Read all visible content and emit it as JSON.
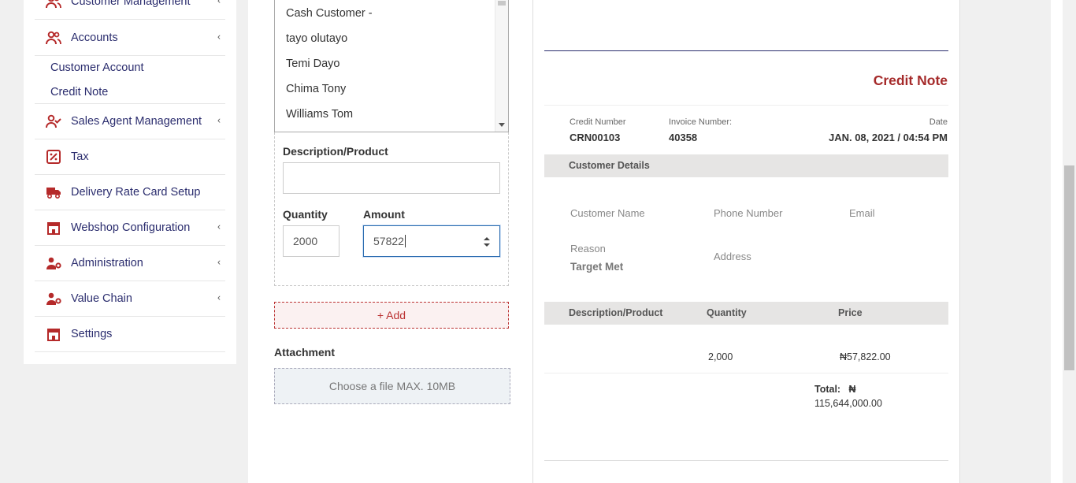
{
  "sidebar": {
    "items": [
      {
        "label": "Customer Management",
        "icon": "users-icon",
        "has_chevron": true
      },
      {
        "label": "Accounts",
        "icon": "users-icon",
        "has_chevron": true
      },
      {
        "label": "Sales Agent Management",
        "icon": "user-check-icon",
        "has_chevron": true
      },
      {
        "label": "Tax",
        "icon": "percent-icon",
        "has_chevron": false
      },
      {
        "label": "Delivery Rate Card Setup",
        "icon": "truck-icon",
        "has_chevron": false
      },
      {
        "label": "Webshop Configuration",
        "icon": "store-icon",
        "has_chevron": true
      },
      {
        "label": "Administration",
        "icon": "user-gear-icon",
        "has_chevron": true
      },
      {
        "label": "Value Chain",
        "icon": "user-gear-icon",
        "has_chevron": true
      },
      {
        "label": "Settings",
        "icon": "store-icon",
        "has_chevron": false
      }
    ],
    "accounts_sub": [
      "Customer Account",
      "Credit Note"
    ],
    "chevron": "‹",
    "accent": "#b52a2a"
  },
  "form": {
    "customer_options": [
      "Cash Customer -",
      "tayo olutayo",
      "Temi Dayo",
      "Chima Tony",
      "Williams Tom"
    ],
    "description_label": "Description/Product",
    "description_value": "",
    "quantity_label": "Quantity",
    "quantity_value": "2000",
    "amount_label": "Amount",
    "amount_value": "57822",
    "add_label": "+ Add",
    "attachment_label": "Attachment",
    "attachment_placeholder": "Choose a file MAX. 10MB"
  },
  "preview": {
    "title": "Credit Note",
    "credit_number_label": "Credit Number",
    "credit_number": "CRN00103",
    "invoice_number_label": "Invoice Number:",
    "invoice_number": "40358",
    "date_label": "Date",
    "date_value": "JAN. 08, 2021 / 04:54 PM",
    "customer_details_label": "Customer Details",
    "customer_name_label": "Customer Name",
    "phone_label": "Phone Number",
    "email_label": "Email",
    "reason_label": "Reason",
    "reason_value": "Target Met",
    "address_label": "Address",
    "table_headers": [
      "Description/Product",
      "Quantity",
      "Price"
    ],
    "row": {
      "description": "",
      "quantity": "2,000",
      "price": "₦57,822.00"
    },
    "total_label": "Total:",
    "total_currency": "₦",
    "total_value": "115,644,000.00"
  },
  "colors": {
    "brand": "#b52a2a",
    "nav_text": "#2b2d6e",
    "title": "#a52a2a"
  }
}
